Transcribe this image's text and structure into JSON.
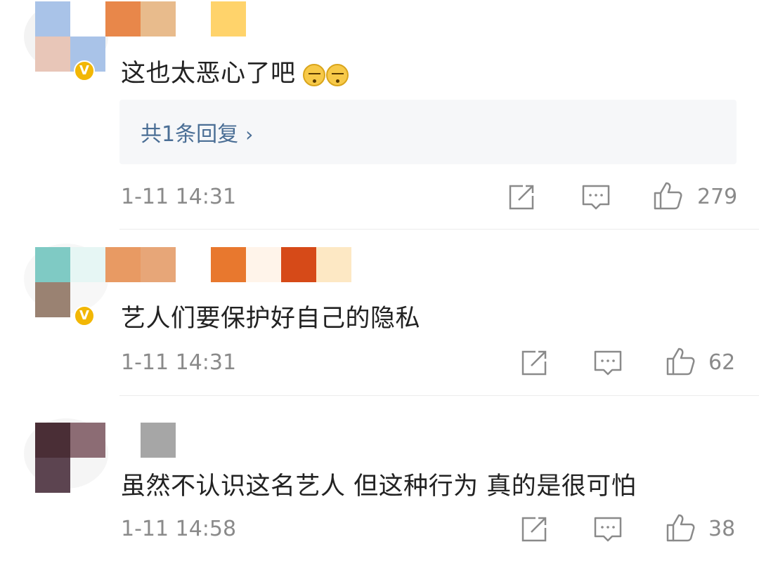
{
  "comments": [
    {
      "text": "这也太恶心了吧",
      "emoji": [
        "sleepy-face-emoji",
        "sleepy-face-emoji"
      ],
      "verified": true,
      "reply_summary": "共1条回复",
      "time": "1-11 14:31",
      "likes": "279",
      "mosaic_colors": [
        "#a9c3e8",
        "#ffffff",
        "#e8874a",
        "#e8bb8c",
        "#ffffff",
        "#ffd36b",
        "#e8c6b8",
        "#a9c3e8"
      ]
    },
    {
      "text": "艺人们要保护好自己的隐私",
      "verified": true,
      "time": "1-11 14:31",
      "likes": "62",
      "mosaic_colors": [
        "#7fcac4",
        "#e6f6f4",
        "#e89a63",
        "#e7a678",
        "#ffffff",
        "#e8782e",
        "#fff4ea",
        "#d64a18",
        "#fde8c4",
        "#9a8272"
      ]
    },
    {
      "text": "虽然不认识这名艺人 但这种行为 真的是很可怕",
      "verified": false,
      "time": "1-11 14:58",
      "likes": "38",
      "mosaic_colors": [
        "#4a2e36",
        "#8c6c74",
        "#a6a6a6",
        "#5c4450",
        "#ffffff"
      ]
    }
  ],
  "icons": {
    "repost": "share-icon",
    "comment": "comment-icon",
    "like": "thumbs-up-icon",
    "badge": "verified-badge-icon",
    "chevron": "chevron-right-icon"
  },
  "colors": {
    "link": "#4a6e95",
    "meta": "#8a8a8a",
    "badge": "#f2b705"
  }
}
